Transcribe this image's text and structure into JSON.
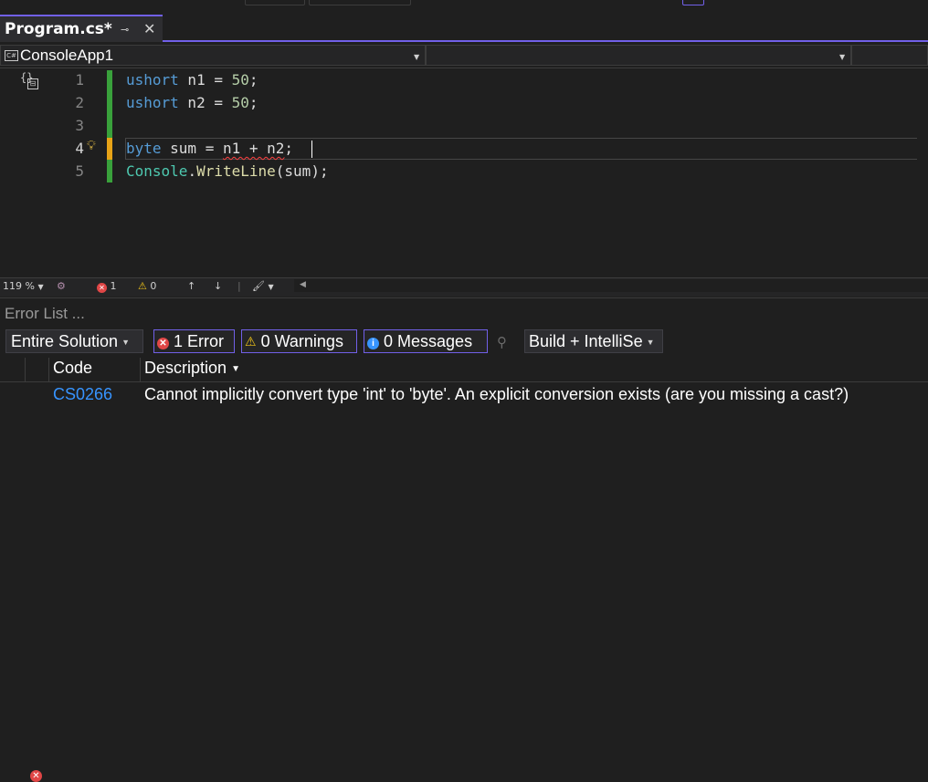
{
  "tab": {
    "title": "Program.cs*",
    "pin_glyph": "⊸",
    "close_glyph": "✕"
  },
  "nav": {
    "project": "ConsoleApp1",
    "member": ""
  },
  "editor": {
    "line_numbers": [
      "1",
      "2",
      "3",
      "4",
      "5"
    ],
    "lines": [
      {
        "tokens": [
          {
            "t": "ushort",
            "c": "kw"
          },
          {
            "t": " n1 = ",
            "c": "pl"
          },
          {
            "t": "50",
            "c": "nm"
          },
          {
            "t": ";",
            "c": "pl"
          }
        ]
      },
      {
        "tokens": [
          {
            "t": "ushort",
            "c": "kw"
          },
          {
            "t": " n2 = ",
            "c": "pl"
          },
          {
            "t": "50",
            "c": "nm"
          },
          {
            "t": ";",
            "c": "pl"
          }
        ]
      },
      {
        "tokens": []
      },
      {
        "tokens": [
          {
            "t": "byte",
            "c": "kw"
          },
          {
            "t": " sum = ",
            "c": "pl"
          },
          {
            "t": "n1 + n2",
            "c": "pl squiggle"
          },
          {
            "t": ";",
            "c": "pl"
          }
        ]
      },
      {
        "tokens": [
          {
            "t": "Console",
            "c": "ty"
          },
          {
            "t": ".",
            "c": "pl"
          },
          {
            "t": "WriteLine",
            "c": "mt"
          },
          {
            "t": "(sum);",
            "c": "pl"
          }
        ]
      }
    ]
  },
  "status": {
    "zoom": "119 %",
    "errors": "1",
    "warnings": "0",
    "up": "↑",
    "down": "↓"
  },
  "error_list": {
    "title": "Error List ...",
    "scope": "Entire Solution",
    "errors_btn": "1 Error",
    "warnings_btn": "0 Warnings",
    "messages_btn": "0 Messages",
    "source": "Build + IntelliSe",
    "columns": {
      "code": "Code",
      "description": "Description"
    },
    "rows": [
      {
        "code": "CS0266",
        "description": "Cannot implicitly convert type 'int' to 'byte'. An explicit conversion exists (are you missing a cast?)"
      }
    ]
  },
  "colors": {
    "accent": "#7160e8",
    "error": "#e04646",
    "warning": "#f0c419",
    "info": "#3794ff",
    "changed": "#39a13b",
    "link": "#3794ff"
  },
  "icons": [
    "pin-icon",
    "close-icon",
    "csharp-file-icon",
    "scope-icon",
    "lightbulb-icon",
    "error-icon",
    "warning-icon",
    "info-icon",
    "filter-icon",
    "chevron-down-icon"
  ]
}
